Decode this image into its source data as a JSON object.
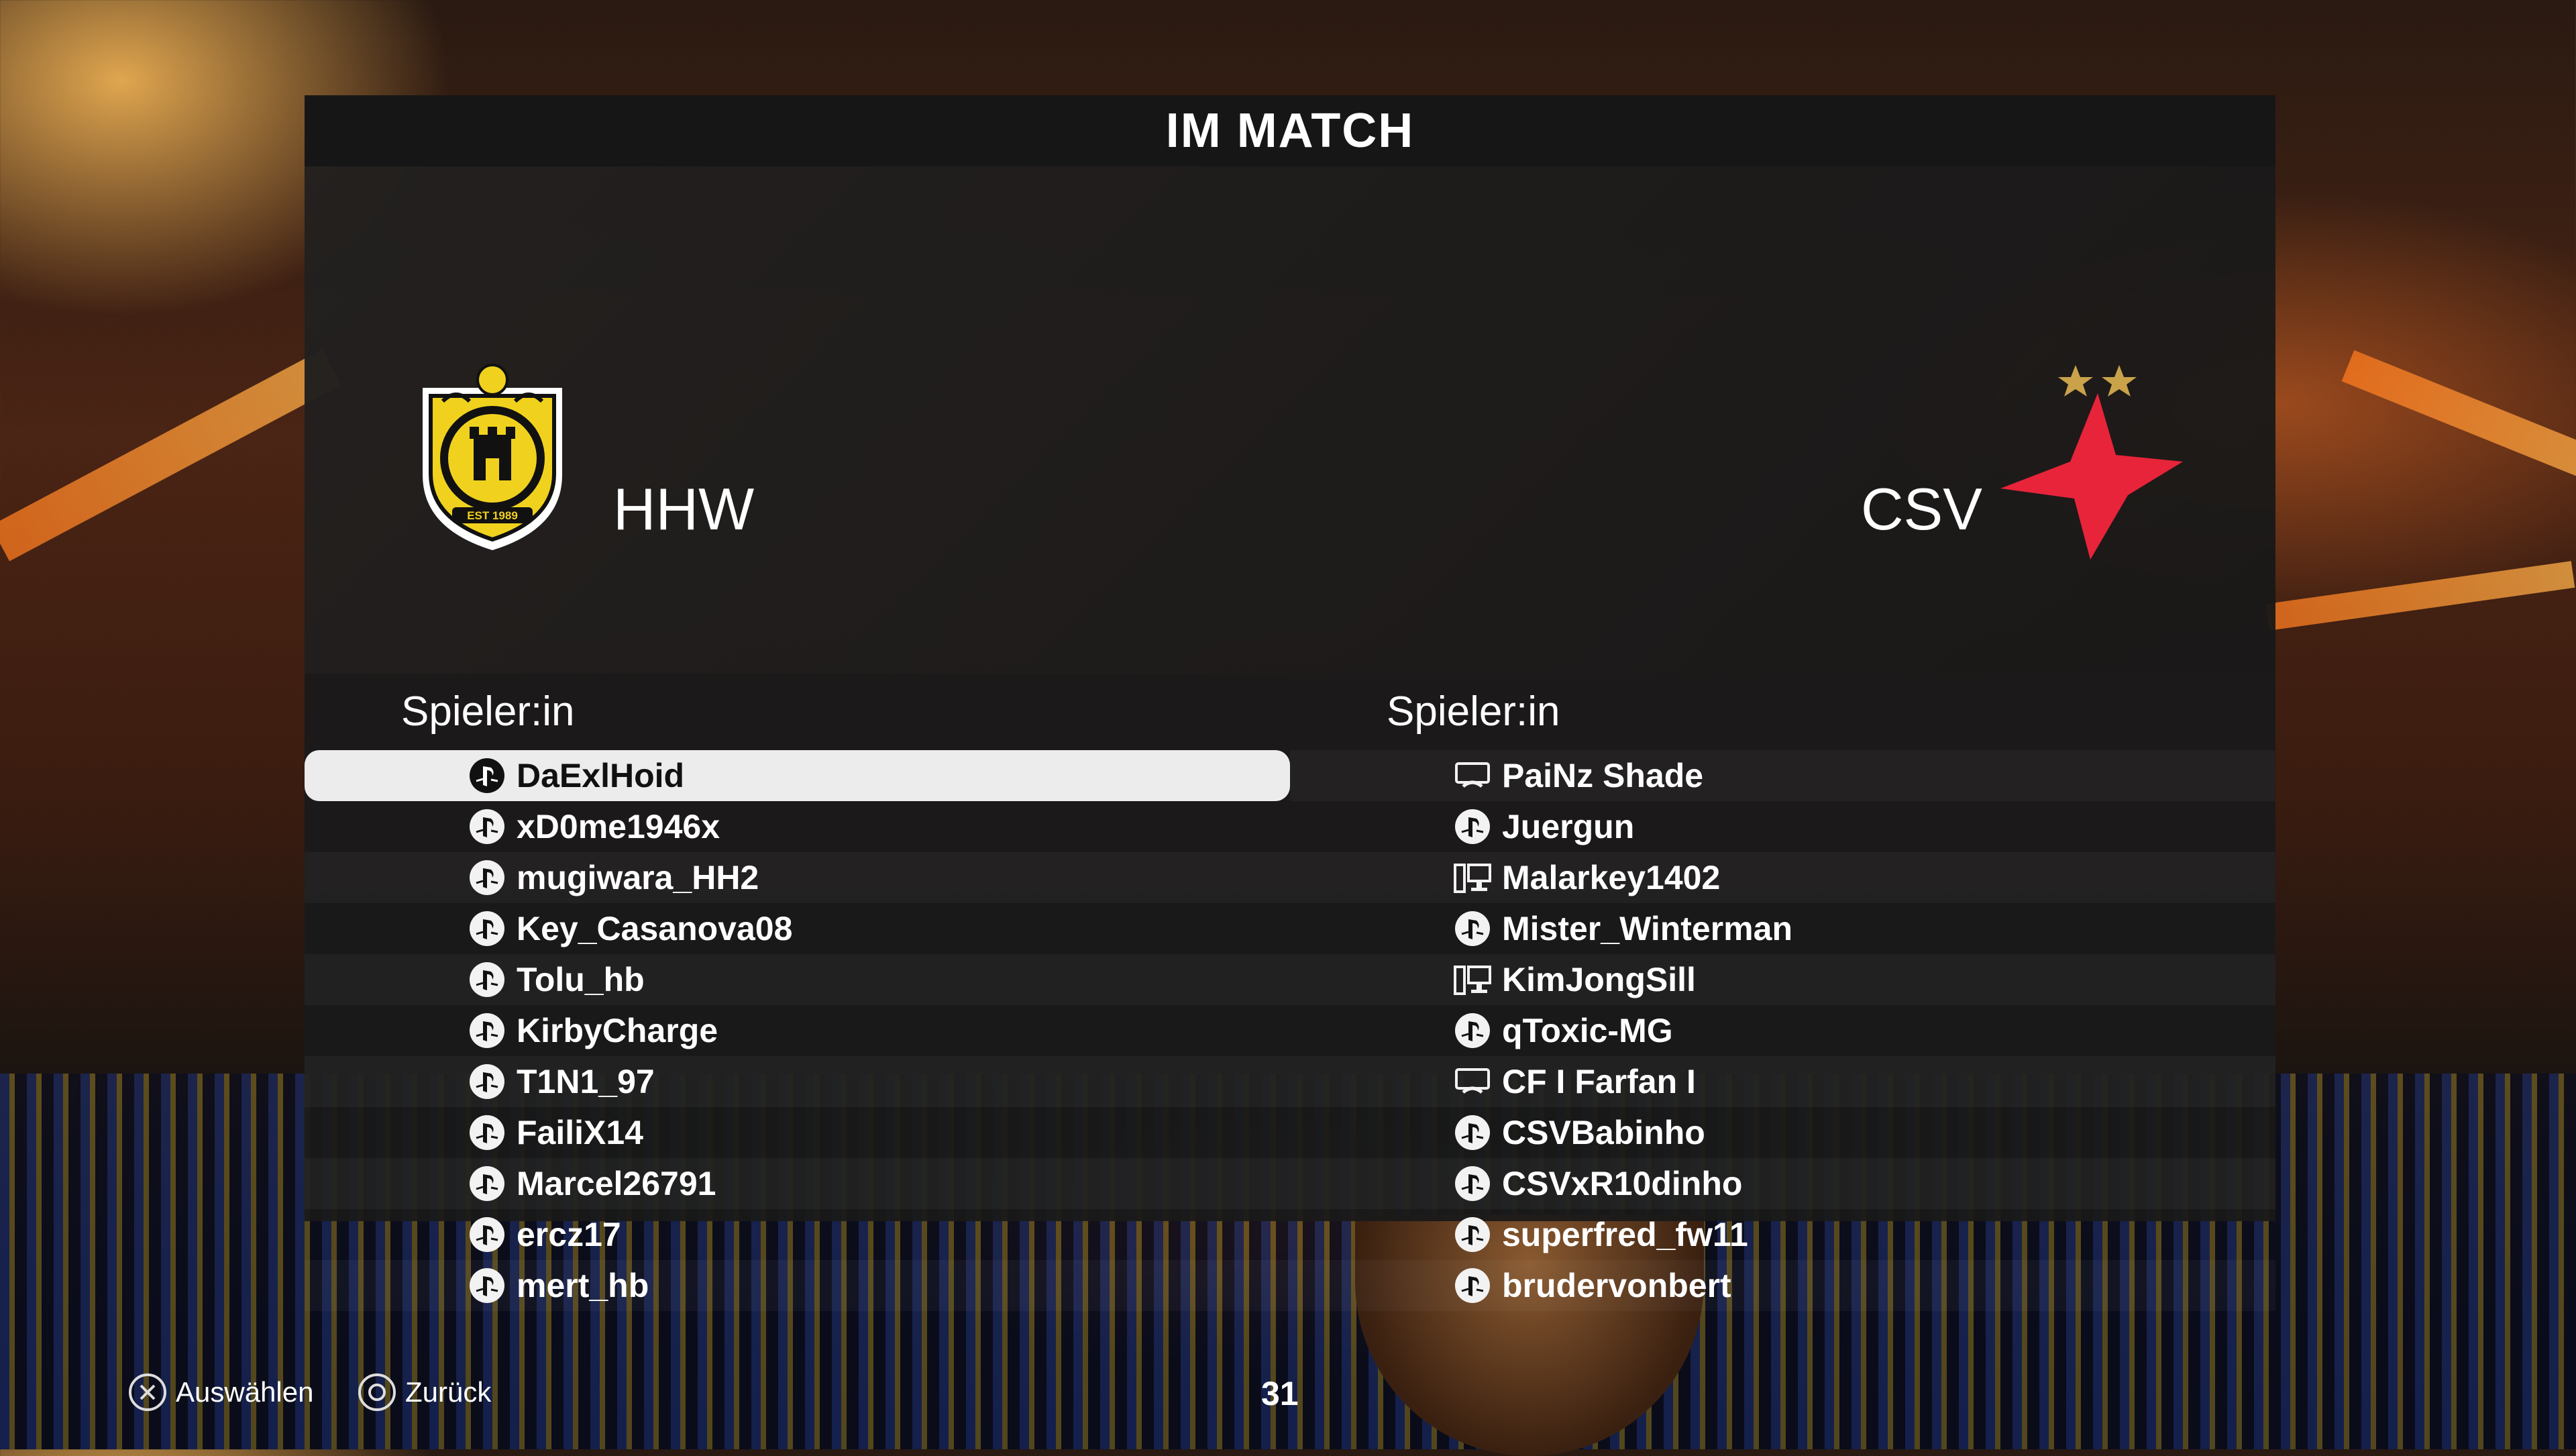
{
  "title": "IM MATCH",
  "home": {
    "name": "HHW",
    "crest_text": "EST 1989",
    "header": "Spieler:in",
    "players": [
      {
        "name": "DaExlHoid",
        "platform": "playstation-icon",
        "selected": true
      },
      {
        "name": "xD0me1946x",
        "platform": "playstation-icon"
      },
      {
        "name": "mugiwara_HH2",
        "platform": "playstation-icon"
      },
      {
        "name": "Key_Casanova08",
        "platform": "playstation-icon"
      },
      {
        "name": "Tolu_hb",
        "platform": "playstation-icon"
      },
      {
        "name": "KirbyCharge",
        "platform": "playstation-icon"
      },
      {
        "name": "T1N1_97",
        "platform": "playstation-icon"
      },
      {
        "name": "FailiX14",
        "platform": "playstation-icon"
      },
      {
        "name": "Marcel26791",
        "platform": "playstation-icon"
      },
      {
        "name": "ercz17",
        "platform": "playstation-icon"
      },
      {
        "name": "mert_hb",
        "platform": "playstation-icon"
      }
    ]
  },
  "away": {
    "name": "CSV",
    "header": "Spieler:in",
    "players": [
      {
        "name": "PaiNz Shade",
        "platform": "xbox-icon"
      },
      {
        "name": "Juergun",
        "platform": "playstation-icon"
      },
      {
        "name": "Malarkey1402",
        "platform": "pc-icon"
      },
      {
        "name": "Mister_Winterman",
        "platform": "playstation-icon"
      },
      {
        "name": "KimJongSill",
        "platform": "pc-icon"
      },
      {
        "name": "qToxic-MG",
        "platform": "playstation-icon"
      },
      {
        "name": "CF I Farfan I",
        "platform": "xbox-icon"
      },
      {
        "name": "CSVBabinho",
        "platform": "playstation-icon"
      },
      {
        "name": "CSVxR10dinho",
        "platform": "playstation-icon"
      },
      {
        "name": "superfred_fw11",
        "platform": "playstation-icon"
      },
      {
        "name": "brudervonbert",
        "platform": "playstation-icon"
      }
    ]
  },
  "footer": {
    "select_label": "Auswählen",
    "back_label": "Zurück",
    "counter": "31"
  },
  "colors": {
    "crest_yellow": "#f0d21e",
    "crest_black": "#111111",
    "star_red": "#e8243a",
    "star_gold": "#c9a24a",
    "selected_row": "#ececec"
  }
}
